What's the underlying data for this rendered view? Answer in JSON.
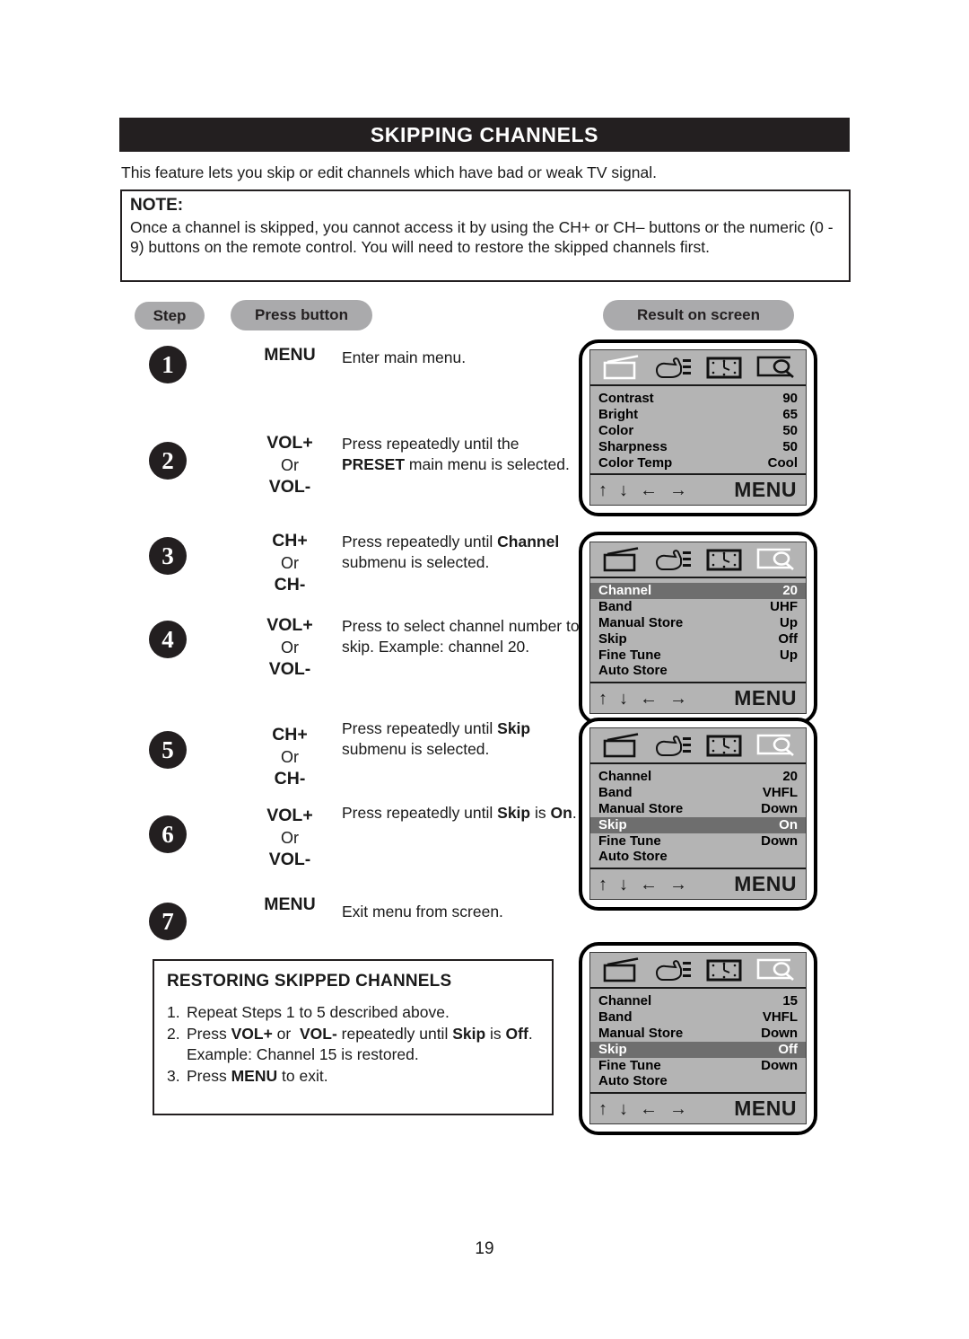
{
  "header": {
    "title": "SKIPPING CHANNELS"
  },
  "intro": "This feature lets you skip or edit channels which have bad or weak TV signal.",
  "note": {
    "label": "NOTE:",
    "body": "Once a channel is skipped, you cannot access it by using the CH+ or CH– buttons or the numeric (0 - 9) buttons on the remote control. You will need to restore the skipped channels first."
  },
  "columns": {
    "step": "Step",
    "press_button": "Press button",
    "result_on_screen": "Result on screen"
  },
  "steps": [
    {
      "number": "1",
      "buttons": [
        "MENU"
      ],
      "or": "",
      "desc_html": "Enter main menu."
    },
    {
      "number": "2",
      "buttons": [
        "VOL+",
        "VOL-"
      ],
      "or": "Or",
      "desc_html": "Press repeatedly until the <b>PRESET</b> main menu is selected."
    },
    {
      "number": "3",
      "buttons": [
        "CH+",
        "CH-"
      ],
      "or": "Or",
      "desc_html": "Press repeatedly until <b>Channel</b> submenu is selected."
    },
    {
      "number": "4",
      "buttons": [
        "VOL+",
        "VOL-"
      ],
      "or": "Or",
      "desc_html": "Press to select channel number to skip. Example: channel 20."
    },
    {
      "number": "5",
      "buttons": [
        "CH+",
        "CH-"
      ],
      "or": "Or",
      "desc_html": "Press repeatedly until <b>Skip</b> submenu is selected."
    },
    {
      "number": "6",
      "buttons": [
        "VOL+",
        "VOL-"
      ],
      "or": "Or",
      "desc_html": "Press repeatedly until <b>Skip</b> is <b>On</b>."
    },
    {
      "number": "7",
      "buttons": [
        "MENU"
      ],
      "or": "",
      "desc_html": "Exit menu from screen."
    }
  ],
  "restoring": {
    "title": "RESTORING SKIPPED CHANNELS",
    "items": [
      {
        "num": "1.",
        "html": "Repeat Steps 1 to 5 described above."
      },
      {
        "num": "2.",
        "html": "Press <b>VOL+</b> or&nbsp; <b>VOL-</b> repeatedly until <b>Skip</b> is <b>Off</b>.&nbsp; Example: Channel 15 is restored."
      },
      {
        "num": "3.",
        "html": "Press <b>MENU</b> to exit."
      }
    ]
  },
  "tv_screens": [
    {
      "name": "picture-menu",
      "active_icon": 0,
      "icons": [
        "tv-picture-icon",
        "hand-preset-icon",
        "clock-timer-icon",
        "preview-search-icon"
      ],
      "rows": [
        {
          "label": "Contrast",
          "value": "90",
          "highlighted": false
        },
        {
          "label": "Bright",
          "value": "65",
          "highlighted": false
        },
        {
          "label": "Color",
          "value": "50",
          "highlighted": false
        },
        {
          "label": "Sharpness",
          "value": "50",
          "highlighted": false
        },
        {
          "label": "Color Temp",
          "value": "Cool",
          "highlighted": false
        }
      ],
      "footer": {
        "up": "↑",
        "down": "↓",
        "left": "←",
        "right": "→",
        "menu": "MENU"
      }
    },
    {
      "name": "preset-channel-menu",
      "active_icon": 3,
      "icons": [
        "tv-picture-icon",
        "hand-preset-icon",
        "clock-timer-icon",
        "preview-search-icon"
      ],
      "rows": [
        {
          "label": "Channel",
          "value": "20",
          "highlighted": true
        },
        {
          "label": "Band",
          "value": "UHF",
          "highlighted": false
        },
        {
          "label": "Manual Store",
          "value": "Up",
          "highlighted": false
        },
        {
          "label": "Skip",
          "value": "Off",
          "highlighted": false
        },
        {
          "label": "Fine Tune",
          "value": "Up",
          "highlighted": false
        },
        {
          "label": "Auto Store",
          "value": "",
          "highlighted": false
        }
      ],
      "footer": {
        "up": "↑",
        "down": "↓",
        "left": "←",
        "right": "→",
        "menu": "MENU"
      }
    },
    {
      "name": "preset-skip-on-menu",
      "active_icon": 3,
      "icons": [
        "tv-picture-icon",
        "hand-preset-icon",
        "clock-timer-icon",
        "preview-search-icon"
      ],
      "rows": [
        {
          "label": "Channel",
          "value": "20",
          "highlighted": false
        },
        {
          "label": "Band",
          "value": "VHFL",
          "highlighted": false
        },
        {
          "label": "Manual Store",
          "value": "Down",
          "highlighted": false
        },
        {
          "label": "Skip",
          "value": "On",
          "highlighted": true
        },
        {
          "label": "Fine Tune",
          "value": "Down",
          "highlighted": false
        },
        {
          "label": "Auto Store",
          "value": "",
          "highlighted": false
        }
      ],
      "footer": {
        "up": "↑",
        "down": "↓",
        "left": "←",
        "right": "→",
        "menu": "MENU"
      }
    },
    {
      "name": "preset-skip-off-menu",
      "active_icon": 3,
      "icons": [
        "tv-picture-icon",
        "hand-preset-icon",
        "clock-timer-icon",
        "preview-search-icon"
      ],
      "rows": [
        {
          "label": "Channel",
          "value": "15",
          "highlighted": false
        },
        {
          "label": "Band",
          "value": "VHFL",
          "highlighted": false
        },
        {
          "label": "Manual Store",
          "value": "Down",
          "highlighted": false
        },
        {
          "label": "Skip",
          "value": "Off",
          "highlighted": true
        },
        {
          "label": "Fine Tune",
          "value": "Down",
          "highlighted": false
        },
        {
          "label": "Auto Store",
          "value": "",
          "highlighted": false
        }
      ],
      "footer": {
        "up": "↑",
        "down": "↓",
        "left": "←",
        "right": "→",
        "menu": "MENU"
      }
    }
  ],
  "page_number": "19",
  "colors": {
    "header_bg": "#231f20",
    "pill_bg": "#aaaaac",
    "menu_bg": "#b4b4b4",
    "menu_highlight": "#6e6e6e"
  }
}
